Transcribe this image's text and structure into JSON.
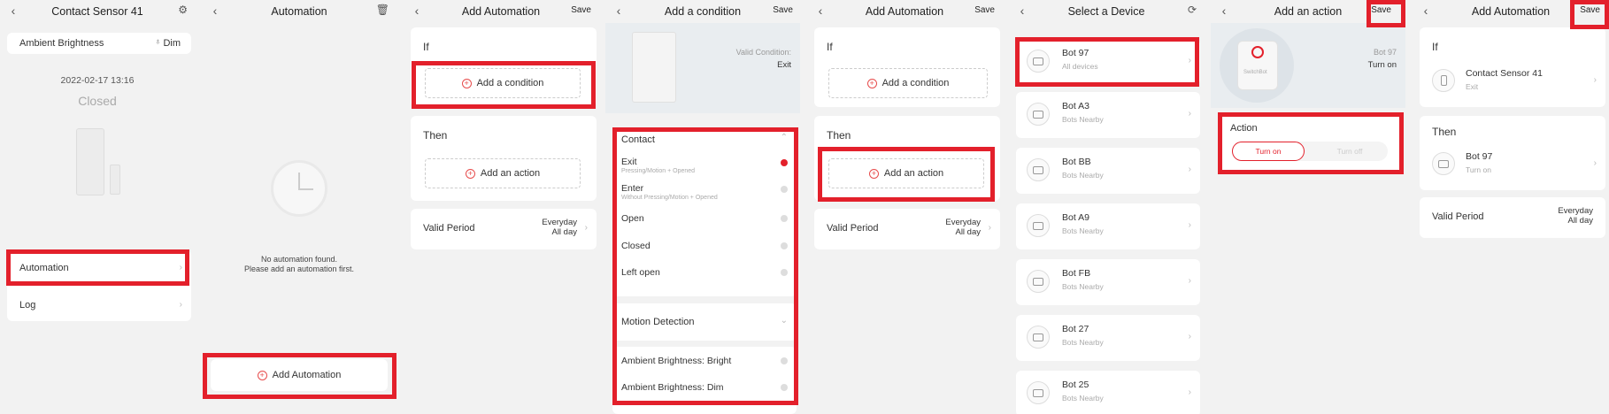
{
  "p1": {
    "title": "Contact Sensor 41",
    "settings_icon": "gear-icon",
    "ambient_label": "Ambient Brightness",
    "ambient_value": "Dim",
    "ambient_icon": "bulb-icon",
    "datetime": "2022-02-17 13:16",
    "state": "Closed",
    "automation": "Automation",
    "log": "Log"
  },
  "p2": {
    "title": "Automation",
    "trash_icon": "trash-icon",
    "empty_line1": "No automation found.",
    "empty_line2": "Please add an automation first.",
    "add_button": "Add Automation"
  },
  "p3": {
    "title": "Add Automation",
    "save": "Save",
    "if": "If",
    "add_condition": "Add a condition",
    "then": "Then",
    "add_action": "Add an action",
    "valid_period": "Valid Period",
    "everyday": "Everyday",
    "all_day": "All day"
  },
  "p4": {
    "title": "Add a condition",
    "save": "Save",
    "valid_condition": "Valid Condition:",
    "valid_value": "Exit",
    "group_contact": "Contact",
    "options": [
      {
        "label": "Exit",
        "sub": "Pressing/Motion + Opened"
      },
      {
        "label": "Enter",
        "sub": "Without Pressing/Motion + Opened"
      },
      {
        "label": "Open",
        "sub": ""
      },
      {
        "label": "Closed",
        "sub": ""
      },
      {
        "label": "Left open",
        "sub": ""
      }
    ],
    "group_motion": "Motion Detection",
    "bright": "Ambient Brightness: Bright",
    "dim": "Ambient Brightness: Dim"
  },
  "p5": {
    "title": "Add Automation",
    "save": "Save",
    "if": "If",
    "add_condition": "Add a condition",
    "then": "Then",
    "add_action": "Add an action",
    "valid_period": "Valid Period",
    "everyday": "Everyday",
    "all_day": "All day"
  },
  "p6": {
    "title": "Select a Device",
    "refresh_icon": "refresh-icon",
    "devices": [
      {
        "name": "Bot 97",
        "sub": "All devices"
      },
      {
        "name": "Bot A3",
        "sub": "Bots Nearby"
      },
      {
        "name": "Bot BB",
        "sub": "Bots Nearby"
      },
      {
        "name": "Bot A9",
        "sub": "Bots Nearby"
      },
      {
        "name": "Bot FB",
        "sub": "Bots Nearby"
      },
      {
        "name": "Bot 27",
        "sub": "Bots Nearby"
      },
      {
        "name": "Bot 25",
        "sub": "Bots Nearby"
      }
    ]
  },
  "p7": {
    "title": "Add an action",
    "save": "Save",
    "device_name": "Bot 97",
    "device_state": "Turn on",
    "brand": "SwitchBot",
    "action_label": "Action",
    "turn_on": "Turn on",
    "turn_off": "Turn off"
  },
  "p8": {
    "title": "Add Automation",
    "save": "Save",
    "if": "If",
    "cond_name": "Contact Sensor 41",
    "cond_value": "Exit",
    "then": "Then",
    "action_name": "Bot 97",
    "action_value": "Turn on",
    "valid_period": "Valid Period",
    "everyday": "Everyday",
    "all_day": "All day"
  },
  "colors": {
    "accent": "#e3202b",
    "background": "#f2f2f2"
  }
}
